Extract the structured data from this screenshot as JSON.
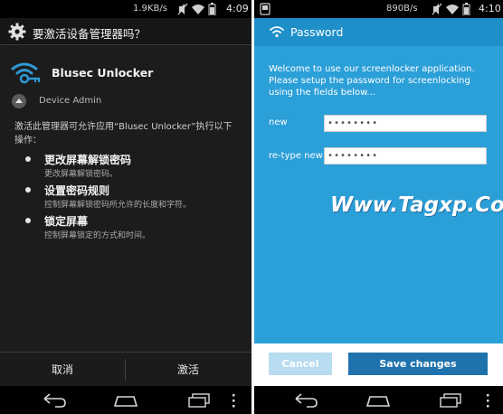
{
  "left_phone": {
    "status_bar": {
      "speed": "1.9KB/s",
      "time": "4:09"
    },
    "dialog": {
      "title": "要激活设备管理器吗？",
      "app_name": "Blusec Unlocker",
      "admin_label": "Device Admin",
      "description": "激活此管理器可允许应用“Blusec Unlocker”执行以下操作：",
      "permissions": [
        {
          "title": "更改屏幕解锁密码",
          "desc": "更改屏幕解锁密码。"
        },
        {
          "title": "设置密码规则",
          "desc": "控制屏幕解锁密码所允许的长度和字符。"
        },
        {
          "title": "锁定屏幕",
          "desc": "控制屏幕锁定的方式和时间。"
        }
      ],
      "cancel_label": "取消",
      "activate_label": "激活"
    }
  },
  "right_phone": {
    "status_bar": {
      "speed": "890B/s",
      "time": "4:10"
    },
    "header_title": "Password",
    "welcome_text": "Welcome to use our screenlocker application. Please setup the password for screenlocking using the fields below...",
    "fields": [
      {
        "label": "new",
        "value": "••••••••"
      },
      {
        "label": "re-type new",
        "value": "••••••••"
      }
    ],
    "watermark": "Www.Tagxp.Com",
    "cancel_label": "Cancel",
    "save_label": "Save changes"
  },
  "colors": {
    "accent_blue": "#2b9fd8",
    "header_blue": "#1e8fc9",
    "save_button": "#1f72ac",
    "cancel_button": "#b8dcf0",
    "dark_bg": "#1c1c1c"
  },
  "icons": {
    "dialog_header": "gear-icon",
    "app": "wifi-key-icon",
    "admin": "expand-up-icon",
    "nav": [
      "back-icon",
      "home-icon",
      "recents-icon",
      "menu-icon"
    ],
    "status": [
      "notification-icon",
      "mute-icon",
      "wifi-signal-icon",
      "battery-icon"
    ]
  }
}
